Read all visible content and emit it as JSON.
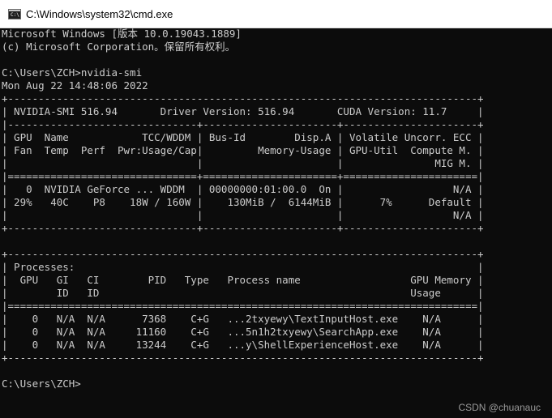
{
  "window": {
    "title": "C:\\Windows\\system32\\cmd.exe",
    "icon_glyph": "C:\\"
  },
  "console": {
    "lines": [
      "Microsoft Windows [版本 10.0.19043.1889]",
      "(c) Microsoft Corporation。保留所有权利。",
      "",
      "C:\\Users\\ZCH>nvidia-smi",
      "Mon Aug 22 14:48:06 2022",
      "+-----------------------------------------------------------------------------+",
      "| NVIDIA-SMI 516.94       Driver Version: 516.94       CUDA Version: 11.7     |",
      "|-------------------------------+----------------------+----------------------+",
      "| GPU  Name            TCC/WDDM | Bus-Id        Disp.A | Volatile Uncorr. ECC |",
      "| Fan  Temp  Perf  Pwr:Usage/Cap|         Memory-Usage | GPU-Util  Compute M. |",
      "|                               |                      |               MIG M. |",
      "|===============================+======================+======================|",
      "|   0  NVIDIA GeForce ... WDDM  | 00000000:01:00.0  On |                  N/A |",
      "| 29%   40C    P8    18W / 160W |    130MiB /  6144MiB |      7%      Default |",
      "|                               |                      |                  N/A |",
      "+-------------------------------+----------------------+----------------------+",
      "",
      "+-----------------------------------------------------------------------------+",
      "| Processes:                                                                  |",
      "|  GPU   GI   CI        PID   Type   Process name                  GPU Memory |",
      "|        ID   ID                                                   Usage      |",
      "|=============================================================================|",
      "|    0   N/A  N/A      7368    C+G   ...2txyewy\\TextInputHost.exe    N/A      |",
      "|    0   N/A  N/A     11160    C+G   ...5n1h2txyewy\\SearchApp.exe    N/A      |",
      "|    0   N/A  N/A     13244    C+G   ...y\\ShellExperienceHost.exe    N/A      |",
      "+-----------------------------------------------------------------------------+",
      "",
      "C:\\Users\\ZCH>"
    ]
  },
  "watermark": "CSDN @chuanauc",
  "colors": {
    "console_bg": "#0c0c0c",
    "console_fg": "#cccccc",
    "titlebar_bg": "#ffffff"
  }
}
